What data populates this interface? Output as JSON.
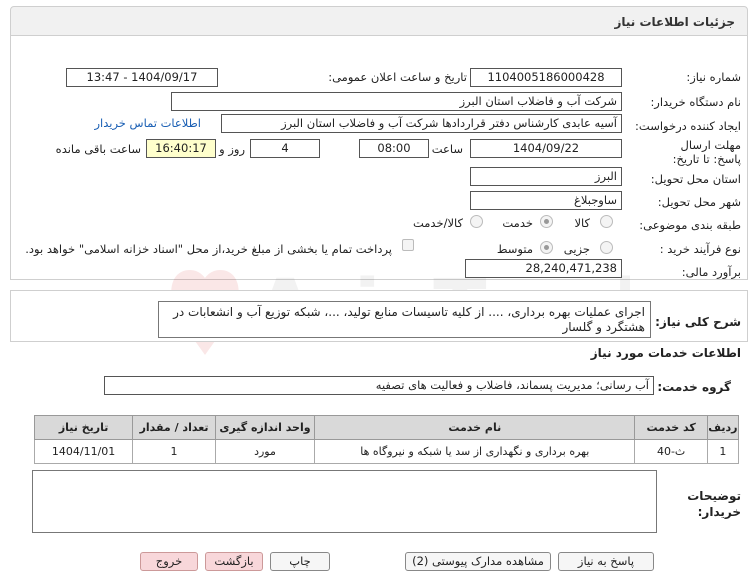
{
  "page": {
    "title": "جزئیات اطلاعات نیاز"
  },
  "fields": {
    "need_number_label": "شماره نیاز:",
    "need_number": "1104005186000428",
    "announce_label": "تاریخ و ساعت اعلان عمومی:",
    "announce_value": "1404/09/17 - 13:47",
    "buyer_org_label": "نام دستگاه خریدار:",
    "buyer_org": "شرکت آب و فاضلاب استان البرز",
    "requester_label": "ایجاد کننده درخواست:",
    "requester": "آسیه عابدی کارشناس دفتر قراردادها شرکت آب و فاضلاب استان البرز",
    "contact_link": "اطلاعات تماس خریدار",
    "deadline_label": "مهلت ارسال پاسخ: تا تاریخ:",
    "deadline_date": "1404/09/22",
    "time_label": "ساعت",
    "deadline_time": "08:00",
    "days_value": "4",
    "days_label": "روز و",
    "remaining_time": "16:40:17",
    "remaining_label": "ساعت باقی مانده",
    "province_label": "استان محل تحویل:",
    "province": "البرز",
    "city_label": "شهر محل تحویل:",
    "city": "ساوجبلاغ",
    "category_label": "طبقه بندی موضوعی:",
    "category_options": [
      "کالا",
      "خدمت",
      "کالا/خدمت"
    ],
    "category_selected": "خدمت",
    "process_label": "نوع فرآیند خرید :",
    "process_options": [
      "جزیی",
      "متوسط"
    ],
    "process_selected": "متوسط",
    "payment_note": "پرداخت تمام یا بخشی از مبلغ خرید،از محل \"اسناد خزانه اسلامی\" خواهد بود.",
    "budget_label": "برآورد مالی:",
    "budget": "28,240,471,238"
  },
  "description": {
    "label": "شرح کلی نیاز:",
    "text": "اجرای عملیات بهره برداری، .... از کلیه تاسیسات منابع تولید، ...، شبکه توزیع آب و انشعابات در هشتگرد و گلسار"
  },
  "services": {
    "section_title": "اطلاعات خدمات مورد نیاز",
    "group_label": "گروه خدمت:",
    "group_value": "آب رسانی؛ مدیریت پسماند، فاضلاب و فعالیت های تصفیه",
    "columns": [
      "ردیف",
      "کد خدمت",
      "نام خدمت",
      "واحد اندازه گیری",
      "تعداد / مقدار",
      "تاریخ نیاز"
    ],
    "rows": [
      [
        "1",
        "ث-40",
        "بهره برداری و نگهداری از سد یا شبکه و نیروگاه ها",
        "مورد",
        "1",
        "1404/11/01"
      ]
    ]
  },
  "notes": {
    "label": "توضیحات خریدار:"
  },
  "buttons": {
    "reply": "پاسخ به نیاز",
    "docs": "مشاهده مدارک پیوستی (2)",
    "print": "چاپ",
    "back": "بازگشت",
    "exit": "خروج"
  },
  "watermark": "AriaTender.neT",
  "colors": {
    "yellow_field": "#ffffcc",
    "link": "#1a5fb4",
    "pink_button": "#f8d7da"
  }
}
